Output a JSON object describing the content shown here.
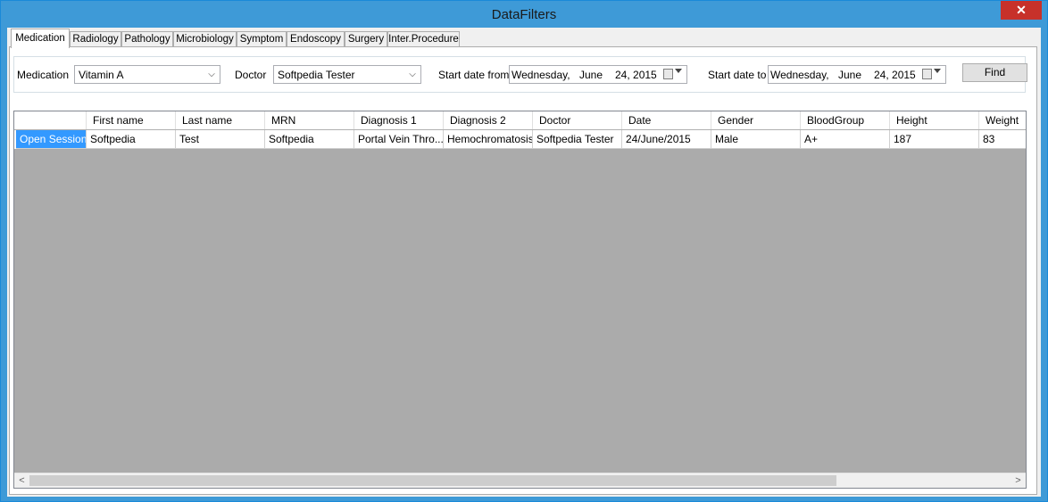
{
  "window": {
    "title": "DataFilters",
    "close_glyph": "✕"
  },
  "tabs": [
    {
      "label": "Medication",
      "active": true
    },
    {
      "label": "Radiology"
    },
    {
      "label": "Pathology"
    },
    {
      "label": "Microbiology"
    },
    {
      "label": "Symptom"
    },
    {
      "label": "Endoscopy"
    },
    {
      "label": "Surgery"
    },
    {
      "label": "Inter.Procedure"
    }
  ],
  "filters": {
    "medication_label": "Medication",
    "medication_value": "Vitamin A",
    "doctor_label": "Doctor",
    "doctor_value": "Softpedia Tester",
    "start_from_label": "Start date from",
    "start_from": {
      "weekday": "Wednesday,",
      "month": "June",
      "day_year": "24, 2015"
    },
    "start_to_label": "Start date to",
    "start_to": {
      "weekday": "Wednesday,",
      "month": "June",
      "day_year": "24, 2015"
    },
    "find_label": "Find"
  },
  "grid": {
    "columns": [
      "",
      "First name",
      "Last name",
      "MRN",
      "Diagnosis 1",
      "Diagnosis 2",
      "Doctor",
      "Date",
      "Gender",
      "BloodGroup",
      "Height",
      "Weight"
    ],
    "rows": [
      [
        "Open Session",
        "Softpedia",
        "Test",
        "Softpedia",
        "Portal Vein Thro...",
        "Hemochromatosis",
        "Softpedia Tester",
        "24/June/2015",
        "Male",
        "A+",
        "187",
        "83"
      ]
    ],
    "selected_cell_color": "#3399ff",
    "empty_area_color": "#ababab"
  },
  "scrollbar": {
    "left_glyph": "<",
    "right_glyph": ">"
  },
  "colors": {
    "titlebar": "#3e9ad7",
    "close": "#c7312a"
  }
}
